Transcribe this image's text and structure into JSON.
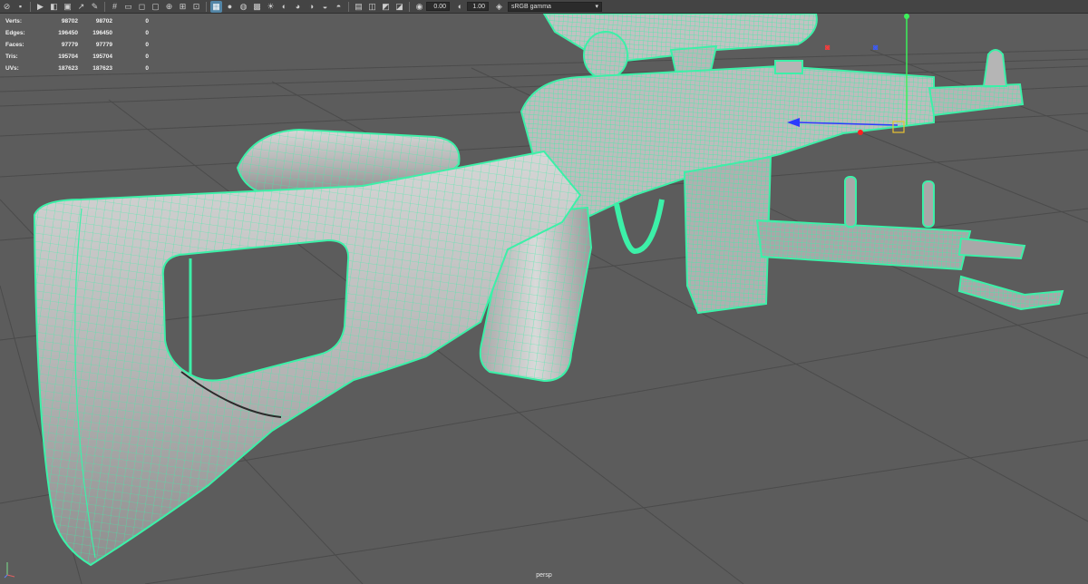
{
  "toolbar": {
    "exposure": "0.00",
    "gamma": "1.00",
    "color_space": "sRGB gamma"
  },
  "hud": {
    "rows": [
      {
        "label": "Verts:",
        "values": [
          "98702",
          "98702",
          "0"
        ]
      },
      {
        "label": "Edges:",
        "values": [
          "196450",
          "196450",
          "0"
        ]
      },
      {
        "label": "Faces:",
        "values": [
          "97779",
          "97779",
          "0"
        ]
      },
      {
        "label": "Tris:",
        "values": [
          "195704",
          "195704",
          "0"
        ]
      },
      {
        "label": "UVs:",
        "values": [
          "187623",
          "187623",
          "0"
        ]
      }
    ]
  },
  "viewport": {
    "camera": "persp",
    "wire_color": "#3cf0a8",
    "background": "#5c5c5c",
    "grid_color": "#4a4a4a"
  }
}
